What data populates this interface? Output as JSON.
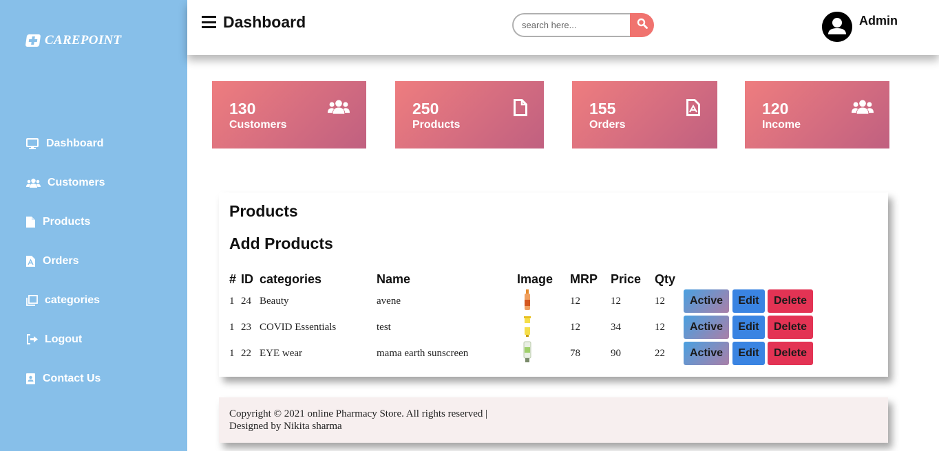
{
  "brand": {
    "name": "CAREPOINT"
  },
  "sidebar": {
    "items": [
      {
        "label": "Dashboard",
        "icon": "monitor-icon"
      },
      {
        "label": "Customers",
        "icon": "users-icon"
      },
      {
        "label": "Products",
        "icon": "file-icon"
      },
      {
        "label": "Orders",
        "icon": "pdf-file-icon"
      },
      {
        "label": "categories",
        "icon": "clone-icon"
      },
      {
        "label": "Logout",
        "icon": "sign-out-icon"
      },
      {
        "label": "Contact Us",
        "icon": "contact-card-icon"
      }
    ]
  },
  "header": {
    "title": "Dashboard",
    "search_placeholder": "search here...",
    "user_name": "Admin"
  },
  "cards": [
    {
      "value": "130",
      "label": "Customers",
      "icon": "users-icon"
    },
    {
      "value": "250",
      "label": "Products",
      "icon": "file-icon"
    },
    {
      "value": "155",
      "label": "Orders",
      "icon": "pdf-file-icon"
    },
    {
      "value": "120",
      "label": "Income",
      "icon": "users-icon"
    }
  ],
  "products": {
    "title": "Products",
    "subtitle": "Add Products",
    "columns": [
      "#",
      "ID",
      "categories",
      "Name",
      "Image",
      "MRP",
      "Price",
      "Qty"
    ],
    "rows": [
      {
        "num": "1",
        "id": "24",
        "category": "Beauty",
        "name": "avene",
        "image": "product-bottle-image",
        "mrp": "12",
        "price": "12",
        "qty": "12"
      },
      {
        "num": "1",
        "id": "23",
        "category": "COVID Essentials",
        "name": "test",
        "image": "product-tube-image",
        "mrp": "12",
        "price": "34",
        "qty": "12"
      },
      {
        "num": "1",
        "id": "22",
        "category": "EYE wear",
        "name": "mama earth sunscreen",
        "image": "product-sunscreen-image",
        "mrp": "78",
        "price": "90",
        "qty": "22"
      }
    ],
    "actions": {
      "active": "Active",
      "edit": "Edit",
      "delete": "Delete"
    }
  },
  "footer": {
    "line1": "Copyright © 2021 online Pharmacy Store. All rights reserved |",
    "line2": "Designed by Nikita sharma"
  },
  "colors": {
    "sidebar": "#87bfe9",
    "card_gradient_start": "#ee7d7f",
    "card_gradient_end": "#c06080",
    "search_button": "#f0736f",
    "edit_button": "#3a84e2",
    "delete_button": "#e33354"
  }
}
